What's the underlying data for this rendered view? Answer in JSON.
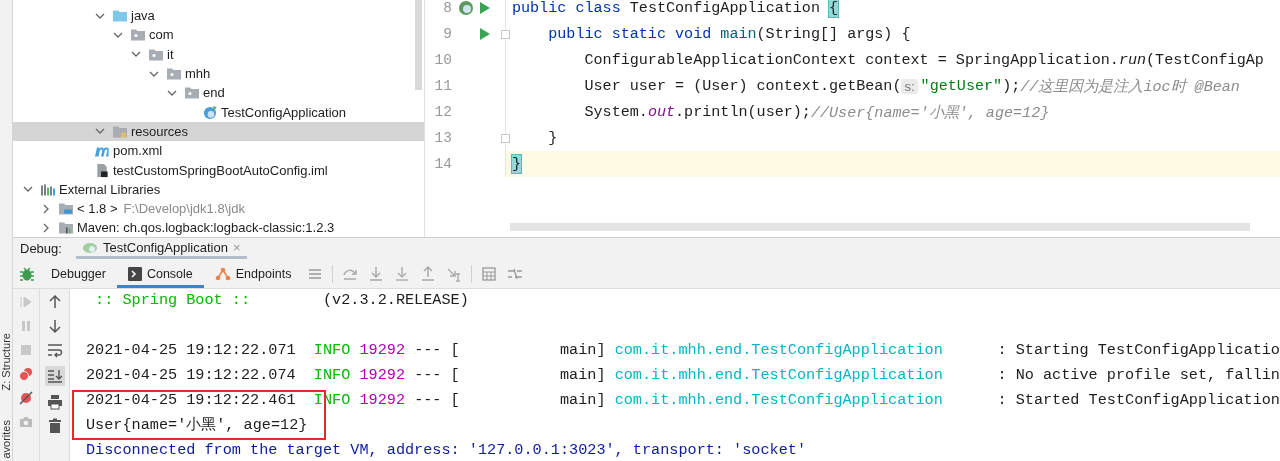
{
  "project_tree": {
    "items": [
      {
        "label": "java",
        "kind": "source-root",
        "expanded": true,
        "selected": false,
        "children": [
          {
            "label": "com",
            "kind": "package",
            "expanded": true,
            "selected": false,
            "children": [
              {
                "label": "it",
                "kind": "package",
                "expanded": true,
                "selected": false,
                "children": [
                  {
                    "label": "mhh",
                    "kind": "package",
                    "expanded": true,
                    "selected": false,
                    "children": [
                      {
                        "label": "end",
                        "kind": "package",
                        "expanded": true,
                        "selected": false,
                        "children": [
                          {
                            "label": "TestConfigApplication",
                            "kind": "spring-class",
                            "selected": false
                          }
                        ]
                      }
                    ]
                  }
                ]
              }
            ]
          }
        ]
      },
      {
        "label": "resources",
        "kind": "resources-root",
        "expanded": true,
        "selected": true
      },
      {
        "label": "pom.xml",
        "kind": "maven-file",
        "selected": false
      },
      {
        "label": "testCustomSpringBootAutoConfig.iml",
        "kind": "module-file",
        "selected": false
      },
      {
        "label": "External Libraries",
        "kind": "libraries",
        "expanded": true,
        "selected": false,
        "children": [
          {
            "label": "< 1.8 >",
            "detail": "F:\\Develop\\jdk1.8\\jdk",
            "kind": "sdk",
            "expanded": false,
            "selected": false
          },
          {
            "label": "Maven: ch.qos.logback:logback-classic:1.2.3",
            "kind": "library",
            "expanded": false,
            "selected": false
          }
        ]
      }
    ]
  },
  "editor": {
    "lines": [
      {
        "number": "8",
        "kind": "spring-run",
        "current": false,
        "tokens": [
          {
            "kind": "keyword",
            "text": "public class "
          },
          {
            "kind": "plain",
            "text": "TestConfigApplication "
          },
          {
            "kind": "brace-match",
            "text": "{"
          }
        ]
      },
      {
        "number": "9",
        "kind": "run",
        "fold": true,
        "current": false,
        "tokens": [
          {
            "kind": "keyword",
            "text": "    public static void "
          },
          {
            "kind": "declaration",
            "text": "main"
          },
          {
            "kind": "plain",
            "text": "(String[] args) {"
          }
        ]
      },
      {
        "number": "10",
        "current": false,
        "tokens": [
          {
            "kind": "plain",
            "text": "        ConfigurableApplicationContext context = SpringApplication."
          },
          {
            "kind": "static-call",
            "text": "run"
          },
          {
            "kind": "plain",
            "text": "(TestConfigAp"
          }
        ]
      },
      {
        "number": "11",
        "current": false,
        "tokens": [
          {
            "kind": "plain",
            "text": "        User user = (User) context.getBean("
          },
          {
            "kind": "hint",
            "text": "s:"
          },
          {
            "kind": "string",
            "text": "\"getUser\""
          },
          {
            "kind": "plain",
            "text": ");"
          },
          {
            "kind": "comment",
            "text": "//这里因为是注入ioc时 @Bean"
          }
        ]
      },
      {
        "number": "12",
        "current": false,
        "tokens": [
          {
            "kind": "plain",
            "text": "        System."
          },
          {
            "kind": "field",
            "text": "out"
          },
          {
            "kind": "plain",
            "text": ".println(user);"
          },
          {
            "kind": "comment",
            "text": "//User{name='小黑', age=12}"
          }
        ]
      },
      {
        "number": "13",
        "fold": true,
        "current": false,
        "tokens": [
          {
            "kind": "plain",
            "text": "    }"
          }
        ]
      },
      {
        "number": "14",
        "current": true,
        "tokens": [
          {
            "kind": "brace-match",
            "text": "}"
          }
        ]
      }
    ]
  },
  "debug": {
    "label": "Debug:",
    "session": {
      "label": "TestConfigApplication",
      "close": "×"
    },
    "tabs": [
      {
        "label": "Debugger",
        "kind": "debugger",
        "selected": false
      },
      {
        "label": "Console",
        "kind": "console",
        "selected": true
      },
      {
        "label": "Endpoints",
        "kind": "endpoints",
        "selected": false
      }
    ],
    "side_labels": [
      "Z: Structure",
      "avorites"
    ]
  },
  "console": {
    "lines": [
      {
        "kind": "banner",
        "tokens": [
          {
            "kind": "banner",
            "text": " :: Spring Boot :: "
          },
          {
            "kind": "plain",
            "text": "       (v2.3.2.RELEASE)"
          }
        ]
      },
      {
        "kind": "log",
        "tokens": [
          {
            "kind": "plain",
            "text": "2021-04-25 19:12:22.071  "
          },
          {
            "kind": "level",
            "text": "INFO "
          },
          {
            "kind": "pid",
            "text": "19292"
          },
          {
            "kind": "plain",
            "text": " --- [           main] "
          },
          {
            "kind": "logger",
            "text": "com.it.mhh.end.TestConfigApplication"
          },
          {
            "kind": "plain",
            "text": "      : Starting TestConfigApplicatio"
          }
        ]
      },
      {
        "kind": "log",
        "tokens": [
          {
            "kind": "plain",
            "text": "2021-04-25 19:12:22.074  "
          },
          {
            "kind": "level",
            "text": "INFO "
          },
          {
            "kind": "pid",
            "text": "19292"
          },
          {
            "kind": "plain",
            "text": " --- [           main] "
          },
          {
            "kind": "logger",
            "text": "com.it.mhh.end.TestConfigApplication"
          },
          {
            "kind": "plain",
            "text": "      : No active profile set, fallin"
          }
        ]
      },
      {
        "kind": "log",
        "tokens": [
          {
            "kind": "plain",
            "text": "2021-04-25 19:12:22.461  "
          },
          {
            "kind": "level",
            "text": "INFO "
          },
          {
            "kind": "pid",
            "text": "19292"
          },
          {
            "kind": "plain",
            "text": " --- [           main] "
          },
          {
            "kind": "logger",
            "text": "com.it.mhh.end.TestConfigApplication"
          },
          {
            "kind": "plain",
            "text": "      : Started TestConfigApplication"
          }
        ]
      },
      {
        "kind": "output",
        "tokens": [
          {
            "kind": "plain",
            "text": "User{name='小黑', age=12}"
          }
        ]
      },
      {
        "kind": "system",
        "tokens": [
          {
            "kind": "system",
            "text": "Disconnected from the target VM, address: '127.0.0.1:3023', transport: 'socket'"
          }
        ]
      }
    ]
  }
}
